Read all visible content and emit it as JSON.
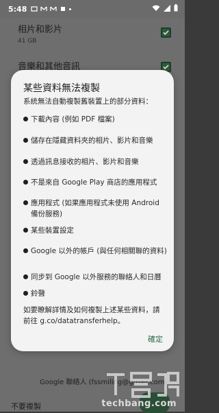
{
  "status_bar": {
    "time": "5:48"
  },
  "background": {
    "items": [
      {
        "title": "相片和影片",
        "subtitle": "41 GB"
      },
      {
        "title": "音樂和其他音訊"
      }
    ],
    "footer_text": "Google 聯絡人 (fssmiling@gmail.com)",
    "skip_label": "不要複製"
  },
  "dialog": {
    "title": "某些資料無法複製",
    "intro": "系統無法自動複製舊裝置上的部分資料：",
    "items": [
      "下載內容 (例如 PDF 檔案)",
      "儲存在隱藏資料夾的相片、影片和音樂",
      "透過訊息接收的相片、影片和音樂",
      "不是來自 Google Play 商店的應用程式",
      "應用程式 (如果應用程式未使用 Android 備份服務)",
      "某些裝置設定",
      "Google 以外的帳戶 (與任何相關聯的資料)",
      "同步到 Google 以外服務的聯絡人和日曆",
      "鈴聲"
    ],
    "note": "如要瞭解詳情及如何複製上述某些資料，請前往 g.co/datatransferhelp。",
    "confirm_label": "確定"
  },
  "watermark": {
    "text": "techbang.com"
  },
  "colors": {
    "accent": "#2d6a4a",
    "checkbox": "#2f5a3c"
  }
}
